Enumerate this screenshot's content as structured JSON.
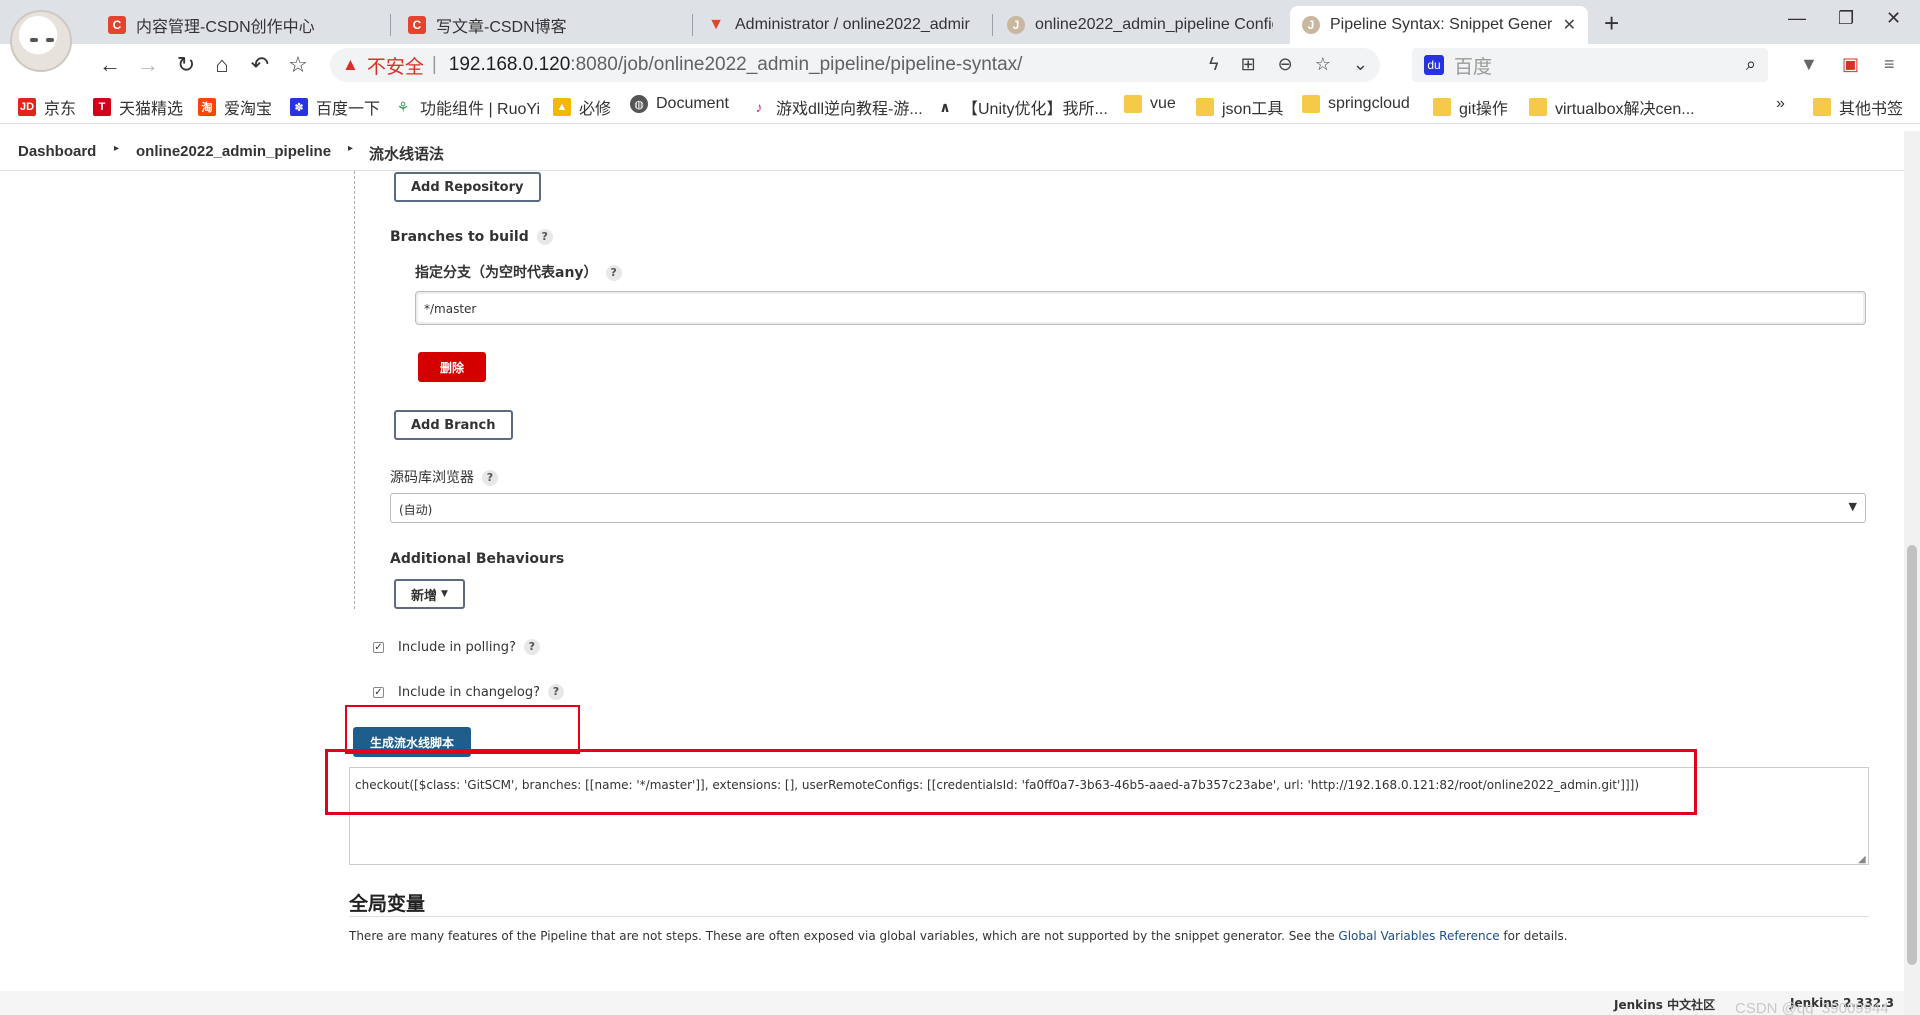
{
  "browser": {
    "tabs": [
      {
        "label": "内容管理-CSDN创作中心",
        "icon": "csdn-icon"
      },
      {
        "label": "写文章-CSDN博客",
        "icon": "csdn-icon"
      },
      {
        "label": "Administrator / online2022_admir",
        "icon": "gitlab-icon"
      },
      {
        "label": "online2022_admin_pipeline Config",
        "icon": "jenkins-icon"
      },
      {
        "label": "Pipeline Syntax: Snippet Gener",
        "icon": "jenkins-icon",
        "active": true
      }
    ],
    "address": {
      "security_label": "不安全",
      "url_host": "192.168.0.120",
      "url_rest": ":8080/job/online2022_admin_pipeline/pipeline-syntax/"
    },
    "search_placeholder": "百度",
    "bookmarks": [
      {
        "label": "京东"
      },
      {
        "label": "天猫精选"
      },
      {
        "label": "爱淘宝"
      },
      {
        "label": "百度一下"
      },
      {
        "label": "功能组件 | RuoYi"
      },
      {
        "label": "必修"
      },
      {
        "label": "Document"
      },
      {
        "label": "游戏dll逆向教程-游..."
      },
      {
        "label": "【Unity优化】我所..."
      },
      {
        "label": "vue"
      },
      {
        "label": "json工具"
      },
      {
        "label": "springcloud"
      },
      {
        "label": "git操作"
      },
      {
        "label": "virtualbox解决cen..."
      },
      {
        "label": "»"
      },
      {
        "label": "其他书签"
      }
    ]
  },
  "breadcrumb": {
    "items": [
      "Dashboard",
      "online2022_admin_pipeline",
      "流水线语法"
    ]
  },
  "form": {
    "add_repository": "Add Repository",
    "branches_label": "Branches to build",
    "branch_spec_label": "指定分支（为空时代表any）",
    "branch_value": "*/master",
    "delete_label": "删除",
    "add_branch": "Add Branch",
    "repo_browser_label": "源码库浏览器",
    "repo_browser_value": "(自动)",
    "additional_label": "Additional Behaviours",
    "add_new": "新增",
    "include_polling": "Include in polling?",
    "include_changelog": "Include in changelog?",
    "generate_label": "生成流水线脚本",
    "output": "checkout([$class: 'GitSCM', branches: [[name: '*/master']], extensions: [], userRemoteConfigs: [[credentialsId: 'fa0ff0a7-3b63-46b5-aaed-a7b357c23abe', url: 'http://192.168.0.121:82/root/online2022_admin.git']]])"
  },
  "globals": {
    "heading": "全局变量",
    "desc_before": "There are many features of the Pipeline that are not steps. These are often exposed via global variables, which are not supported by the snippet generator. See the ",
    "link": "Global Variables Reference",
    "desc_after": " for details."
  },
  "footer": {
    "community": "Jenkins 中文社区",
    "version": "Jenkins 2.332.3"
  },
  "watermark": "CSDN @qq_39009944",
  "colors": {
    "primary_button": "#1f5d8c",
    "danger_button": "#d40000",
    "annotation": "#e3001b",
    "insecure": "#d93025"
  }
}
